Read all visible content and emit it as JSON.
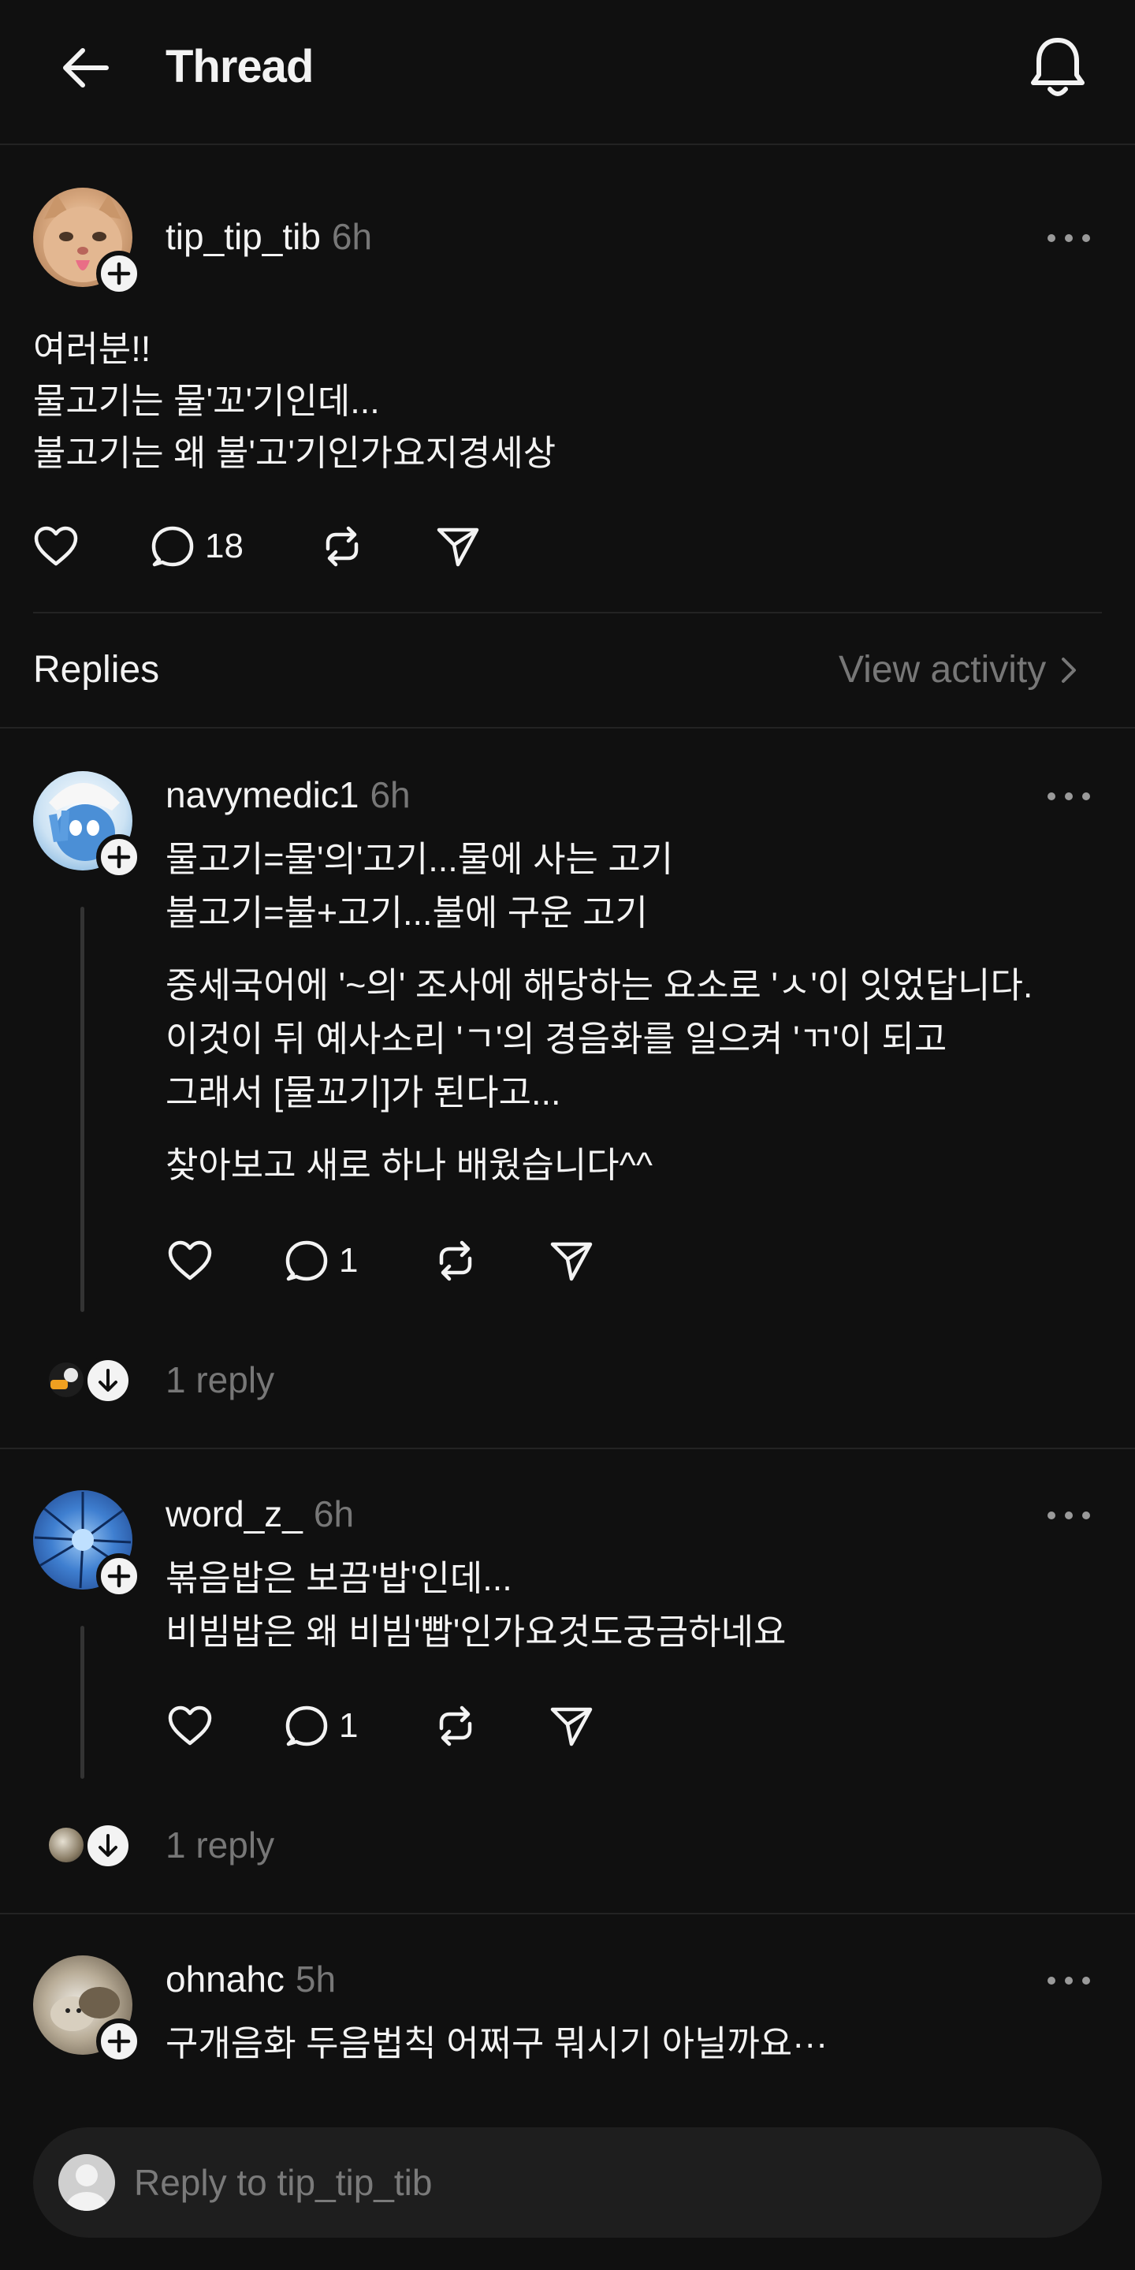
{
  "header": {
    "title": "Thread",
    "back_icon": "arrow-left-icon",
    "bell_icon": "bell-icon"
  },
  "post": {
    "username": "tip_tip_tib",
    "time": "6h",
    "lines": [
      "여러분!!",
      "물고기는 물'꼬'기인데...",
      "불고기는 왜 불'고'기인가요지경세상"
    ],
    "comment_count": "18"
  },
  "replies_header": {
    "label": "Replies",
    "view_activity": "View activity"
  },
  "replies": [
    {
      "username": "navymedic1",
      "time": "6h",
      "paragraphs": [
        [
          "물고기=물'의'고기...물에 사는 고기",
          "불고기=불+고기...불에 구운 고기"
        ],
        [
          "중세국어에 '~의' 조사에 해당하는 요소로 'ㅅ'이 잇었답니다.",
          "이것이 뒤 예사소리 'ㄱ'의 경음화를 일으켜 'ㄲ'이 되고",
          "그래서 [물꼬기]가 된다고..."
        ],
        [
          "찾아보고 새로 하나 배웠습니다^^"
        ]
      ],
      "comment_count": "1",
      "reply_link": "1 reply"
    },
    {
      "username": "word_z_",
      "time": "6h",
      "paragraphs": [
        [
          "볶음밥은 보끔'밥'인데...",
          "비빔밥은 왜 비빔'빱'인가요것도궁금하네요"
        ]
      ],
      "comment_count": "1",
      "reply_link": "1 reply"
    },
    {
      "username": "ohnahc",
      "time": "5h",
      "paragraphs": [
        [
          "구개음화 두음법칙 어쩌구 뭐시기 아닐까요···"
        ]
      ]
    }
  ],
  "composer": {
    "placeholder": "Reply to tip_tip_tib"
  },
  "colors": {
    "background": "#101010",
    "text": "#f3f3f3",
    "muted": "#777777",
    "divider": "#232323",
    "composer_bg": "#1e1e1e"
  }
}
